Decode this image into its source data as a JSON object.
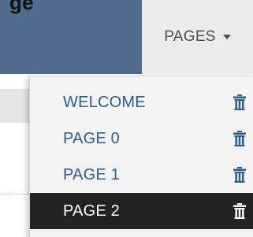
{
  "header": {
    "partial_text": "ge",
    "pages_label": "PAGES"
  },
  "menu": {
    "items": [
      {
        "label": "WELCOME",
        "active": false
      },
      {
        "label": "PAGE 0",
        "active": false
      },
      {
        "label": "PAGE 1",
        "active": false
      },
      {
        "label": "PAGE 2",
        "active": true
      }
    ]
  },
  "icons": {
    "caret": "caret-down-icon",
    "delete": "trash-icon"
  },
  "colors": {
    "header_blue": "#4f6b8d",
    "tab_bg": "#ececec",
    "menu_bg": "#f3f3f3",
    "link_blue": "#2a5d93",
    "active_bg": "#222222"
  }
}
